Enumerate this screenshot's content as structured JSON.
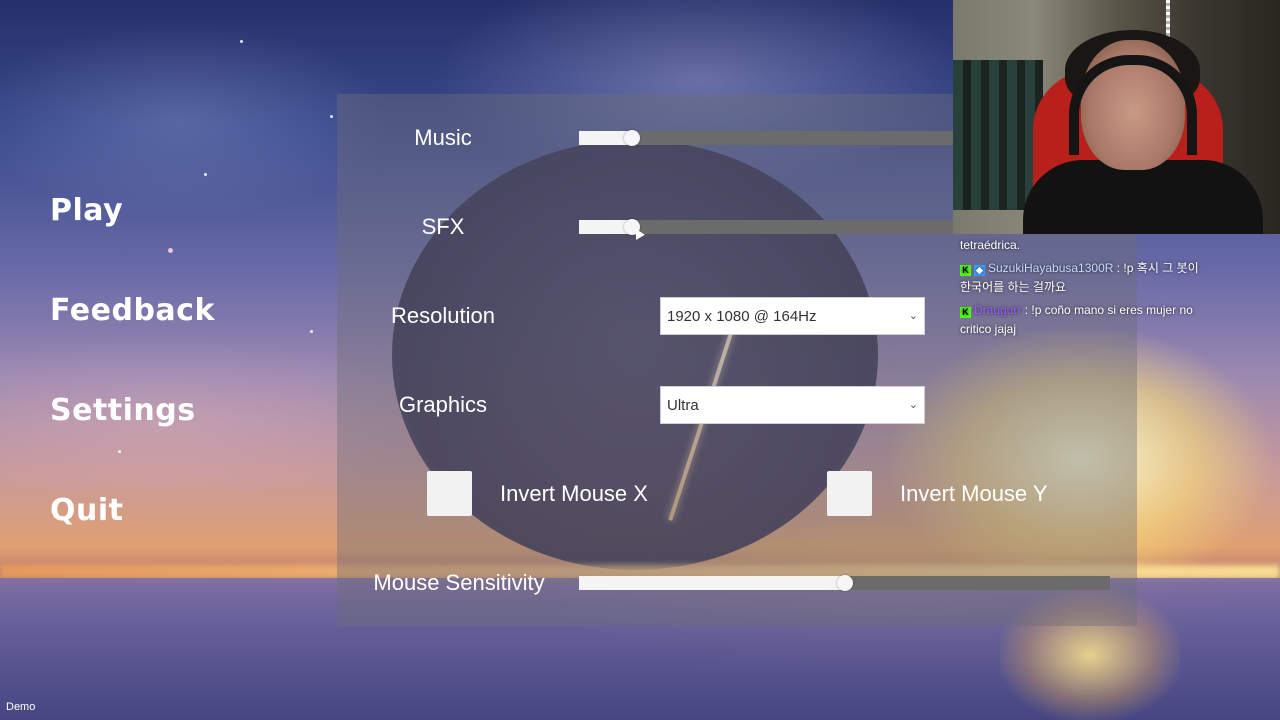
{
  "menu": {
    "items": [
      {
        "label": "Play"
      },
      {
        "label": "Feedback"
      },
      {
        "label": "Settings"
      },
      {
        "label": "Quit"
      }
    ]
  },
  "settings": {
    "music": {
      "label": "Music",
      "value": 0.1
    },
    "sfx": {
      "label": "SFX",
      "value": 0.1
    },
    "resolution": {
      "label": "Resolution",
      "selected": "1920 x 1080 @ 164Hz"
    },
    "graphics": {
      "label": "Graphics",
      "selected": "Ultra"
    },
    "invert_mouse_x": {
      "label": "Invert Mouse X",
      "checked": false
    },
    "invert_mouse_y": {
      "label": "Invert Mouse Y",
      "checked": false
    },
    "mouse_sensitivity": {
      "label": "Mouse Sensitivity",
      "value": 0.5
    }
  },
  "chat": {
    "messages": [
      {
        "user": "",
        "text": "tetraédrica."
      },
      {
        "user": "SuzukiHayabusa1300R",
        "text": ": !p 혹시 그 봇이 한국어를 하는 걸까요"
      },
      {
        "user": "Draugurr",
        "text": ": !p coño mano si eres mujer no critico jajaj"
      }
    ]
  },
  "footer": {
    "build_label": "Demo"
  },
  "colors": {
    "panel": "#6e6e78",
    "slider_track": "#6b6b6b",
    "slider_fill": "#f4f4f4",
    "kick_badge": "#53fc18"
  }
}
